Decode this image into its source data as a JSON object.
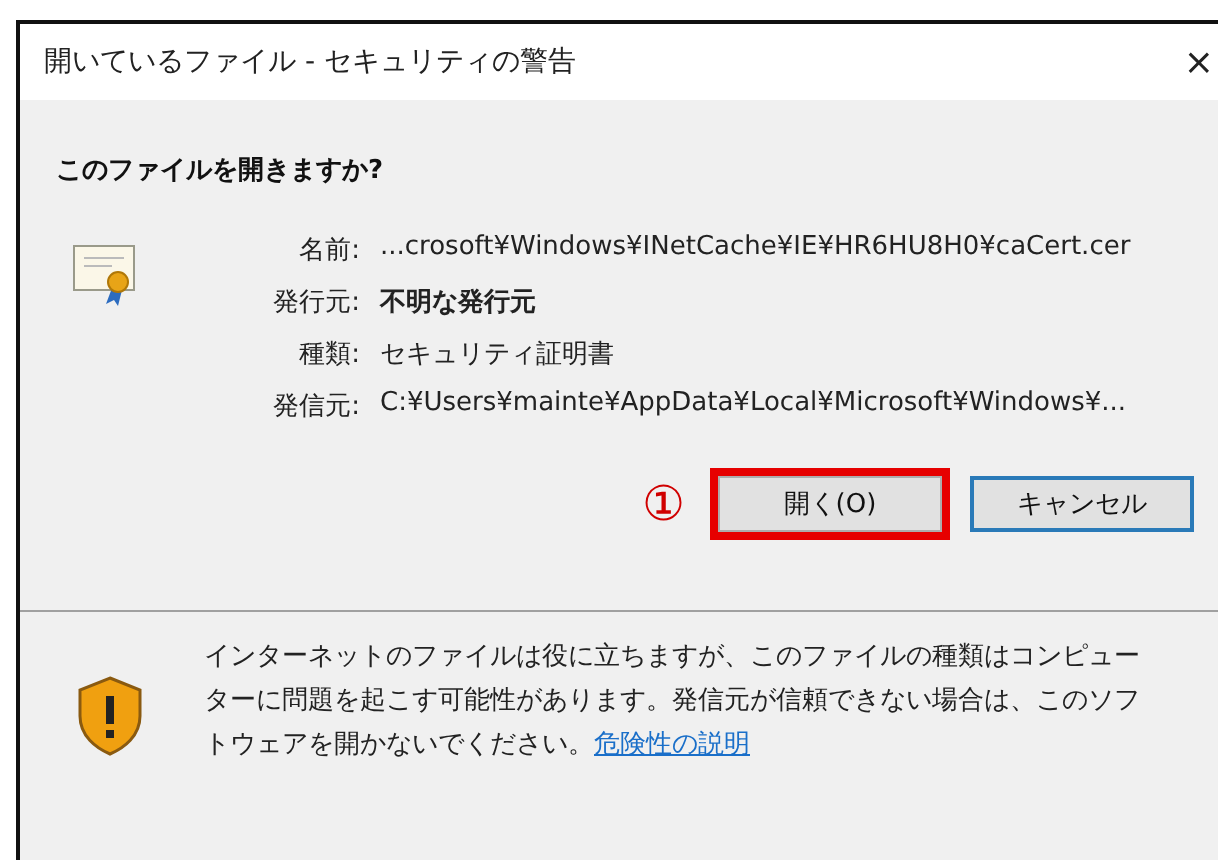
{
  "window": {
    "title": "開いているファイル - セキュリティの警告",
    "close": "×"
  },
  "question": "このファイルを開きますか?",
  "details": [
    {
      "label": "名前:",
      "value": "...crosoft¥Windows¥INetCache¥IE¥HR6HU8H0¥caCert.cer",
      "emphasis": false
    },
    {
      "label": "発行元:",
      "value": "不明な発行元",
      "emphasis": true
    },
    {
      "label": "種類:",
      "value": "セキュリティ証明書",
      "emphasis": false
    },
    {
      "label": "発信元:",
      "value": "C:¥Users¥mainte¥AppData¥Local¥Microsoft¥Windows¥...",
      "emphasis": false
    }
  ],
  "annotation": {
    "marker": "①"
  },
  "buttons": [
    {
      "label": "開く(O)",
      "default": false,
      "annotated": true
    },
    {
      "label": "キャンセル",
      "default": true,
      "annotated": false
    }
  ],
  "warning": {
    "text": "インターネットのファイルは役に立ちますが、このファイルの種類はコンピューターに問題を起こす可能性があります。発信元が信頼できない場合は、このソフトウェアを開かないでください。",
    "link": "危険性の説明"
  }
}
